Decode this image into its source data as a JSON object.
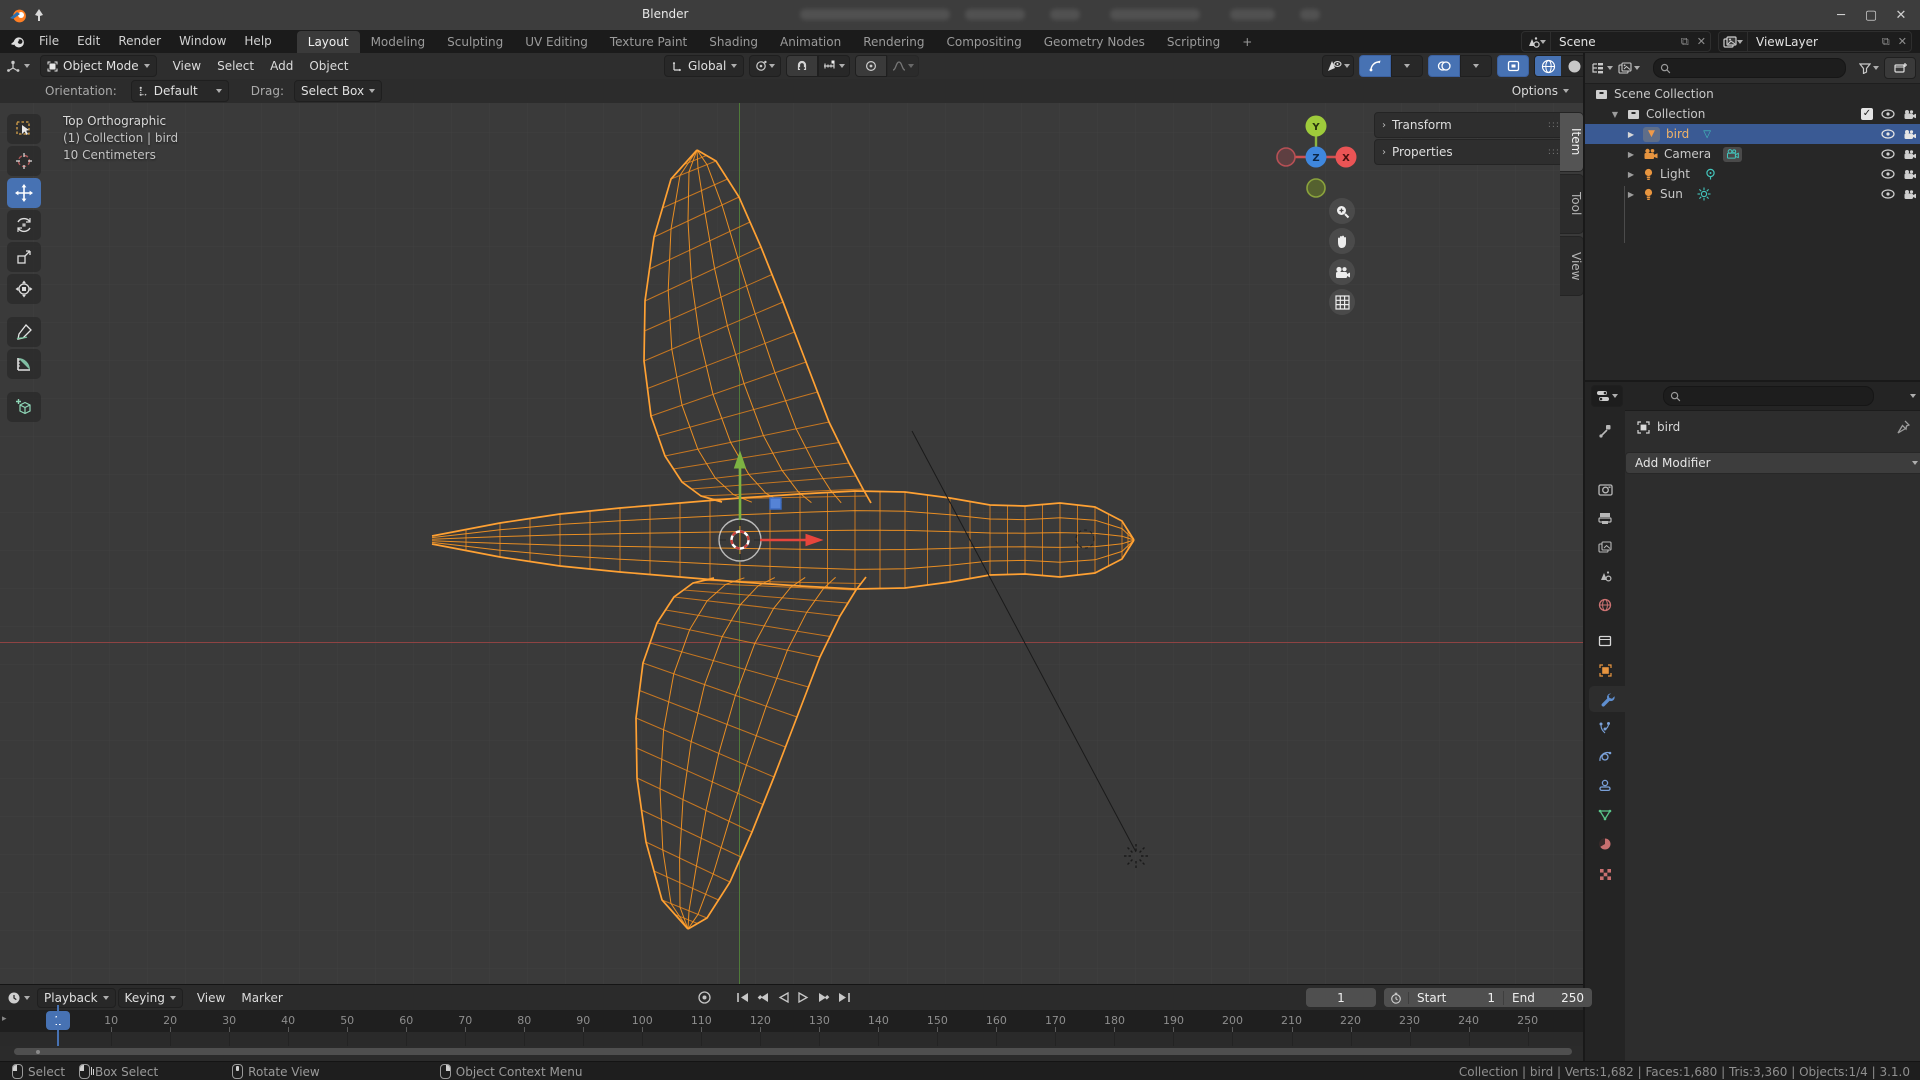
{
  "titlebar": {
    "title": "Blender"
  },
  "topbar": {
    "menus": [
      "File",
      "Edit",
      "Render",
      "Window",
      "Help"
    ],
    "tabs": [
      "Layout",
      "Modeling",
      "Sculpting",
      "UV Editing",
      "Texture Paint",
      "Shading",
      "Animation",
      "Rendering",
      "Compositing",
      "Geometry Nodes",
      "Scripting"
    ],
    "add_tab": "+",
    "scene": "Scene",
    "viewlayer": "ViewLayer"
  },
  "header": {
    "mode": "Object Mode",
    "menus": [
      "View",
      "Select",
      "Add",
      "Object"
    ],
    "orientation": "Global"
  },
  "toolsettings": {
    "orientation_label": "Orientation:",
    "orientation": "Default",
    "drag_label": "Drag:",
    "drag": "Select Box",
    "options": "Options"
  },
  "viewport": {
    "line1": "Top Orthographic",
    "line2": "(1) Collection | bird",
    "line3": "10 Centimeters",
    "axis_x": "X",
    "axis_y": "Y",
    "axis_z": "Z"
  },
  "npanel": {
    "transform": "Transform",
    "properties": "Properties",
    "tabs": [
      "Item",
      "Tool",
      "View"
    ]
  },
  "outliner": {
    "rows": [
      {
        "label": "Scene Collection"
      },
      {
        "label": "Collection"
      },
      {
        "label": "bird"
      },
      {
        "label": "Camera"
      },
      {
        "label": "Light"
      },
      {
        "label": "Sun"
      }
    ]
  },
  "properties": {
    "object": "bird",
    "add_modifier": "Add Modifier"
  },
  "timeline": {
    "menus": [
      "Playback",
      "Keying",
      "View",
      "Marker"
    ],
    "current_frame": "1",
    "start_label": "Start",
    "start_value": "1",
    "end_label": "End",
    "end_value": "250",
    "ticks": [
      10,
      20,
      30,
      40,
      50,
      60,
      70,
      80,
      90,
      100,
      110,
      120,
      130,
      140,
      150,
      160,
      170,
      180,
      190,
      200,
      210,
      220,
      230,
      240,
      250
    ]
  },
  "statusbar": {
    "items": [
      {
        "label": "Select"
      },
      {
        "label": "Box Select"
      },
      {
        "label": "Rotate View"
      },
      {
        "label": "Object Context Menu"
      }
    ],
    "stats": "Collection | bird | Verts:1,682 | Faces:1,680 | Tris:3,360 | Objects:1/4 | 3.1.0"
  },
  "colors": {
    "accent": "#4772b3",
    "selection": "#3a5a94",
    "wire": "#ffa133",
    "axis_x": "#e8453c",
    "axis_y": "#6fae3a"
  }
}
